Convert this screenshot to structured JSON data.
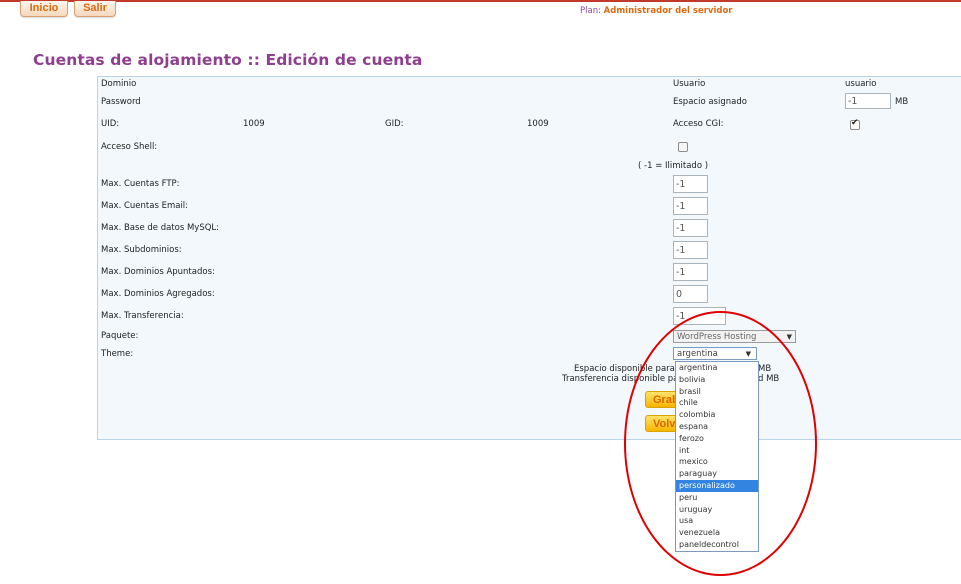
{
  "nav": {
    "inicio": "Inicio",
    "salir": "Salir"
  },
  "plan": {
    "label": "Plan:",
    "value": "Administrador del servidor"
  },
  "page_title": "Cuentas de alojamiento :: Edición de cuenta",
  "form": {
    "dominio_label": "Dominio",
    "usuario_label": "Usuario",
    "usuario_value": "usuario",
    "password_label": "Password",
    "espacio_label": "Espacio asignado",
    "espacio_value": "-1",
    "espacio_unit": "MB",
    "uid_label": "UID:",
    "uid_value": "1009",
    "gid_label": "GID:",
    "gid_value": "1009",
    "cgi_label": "Acceso CGI:",
    "shell_label": "Acceso Shell:",
    "ilimitado_note": "( -1 = Ilimitado )",
    "ftp_label": "Max. Cuentas FTP:",
    "ftp_value": "-1",
    "email_label": "Max. Cuentas Email:",
    "email_value": "-1",
    "mysql_label": "Max. Base de datos MySQL:",
    "mysql_value": "-1",
    "subdom_label": "Max. Subdominios:",
    "subdom_value": "-1",
    "apuntados_label": "Max. Dominios Apuntados:",
    "apuntados_value": "-1",
    "agregados_label": "Max. Dominios Agregados:",
    "agregados_value": "0",
    "transfer_label": "Max. Transferencia:",
    "transfer_value": "-1",
    "paquete_label": "Paquete:",
    "paquete_value": "WordPress Hosting",
    "theme_label": "Theme:",
    "theme_value": "argentina",
    "espacio_disp_text": "Espacio disponible para",
    "espacio_disp_tail": "MB",
    "transfer_disp_text": "Transferencia disponible pa",
    "transfer_disp_tail": "d MB"
  },
  "theme_options": [
    "argentina",
    "bolivia",
    "brasil",
    "chile",
    "colombia",
    "espana",
    "ferozo",
    "int",
    "mexico",
    "paraguay",
    "personalizado",
    "peru",
    "uruguay",
    "usa",
    "venezuela",
    "paneldecontrol"
  ],
  "theme_highlighted": "personalizado",
  "buttons": {
    "grabar": "Grabar",
    "volver": "Volver"
  },
  "colors": {
    "accent_orange": "#e06a10",
    "title_purple": "#8e3f8e",
    "annotation_red": "#e00000",
    "selected_blue": "#3384e0"
  }
}
